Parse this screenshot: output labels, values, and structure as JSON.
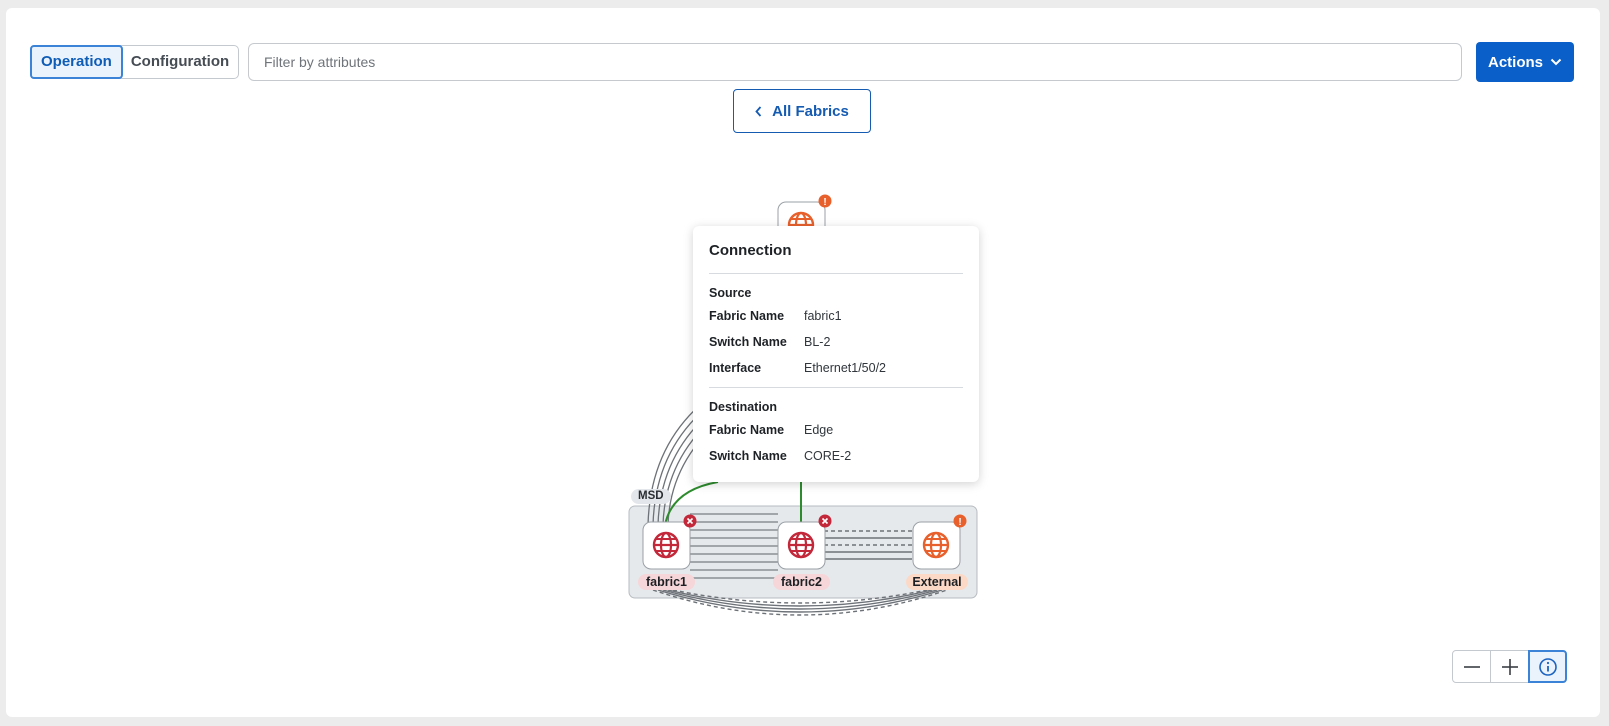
{
  "view_toggle": {
    "operation": "Operation",
    "configuration": "Configuration",
    "selected": "Operation"
  },
  "filter": {
    "placeholder": "Filter by attributes",
    "value": ""
  },
  "actions": {
    "label": "Actions"
  },
  "back": {
    "label": "All Fabrics"
  },
  "topology": {
    "group_label": "MSD",
    "nodes": [
      {
        "label": "fabric1",
        "status": "error",
        "icon": "globe-icon"
      },
      {
        "label": "fabric2",
        "status": "error",
        "icon": "globe-icon"
      },
      {
        "label": "External",
        "status": "warning",
        "icon": "globe-icon"
      },
      {
        "label": "",
        "status": "warning",
        "icon": "globe-icon"
      }
    ]
  },
  "popover": {
    "title": "Connection",
    "source": {
      "heading": "Source",
      "rows": [
        {
          "key": "Fabric Name",
          "value": "fabric1"
        },
        {
          "key": "Switch Name",
          "value": "BL-2"
        },
        {
          "key": "Interface",
          "value": "Ethernet1/50/2"
        }
      ]
    },
    "destination": {
      "heading": "Destination",
      "rows": [
        {
          "key": "Fabric Name",
          "value": "Edge"
        },
        {
          "key": "Switch Name",
          "value": "CORE-2"
        }
      ]
    }
  },
  "zoom_controls": {
    "zoom_out": "minus-icon",
    "zoom_in": "plus-icon",
    "info": "info-icon"
  },
  "colors": {
    "accent": "#0a60c8",
    "error": "#c3283a",
    "warning": "#e8602c",
    "link_active": "#2e8b2e"
  }
}
